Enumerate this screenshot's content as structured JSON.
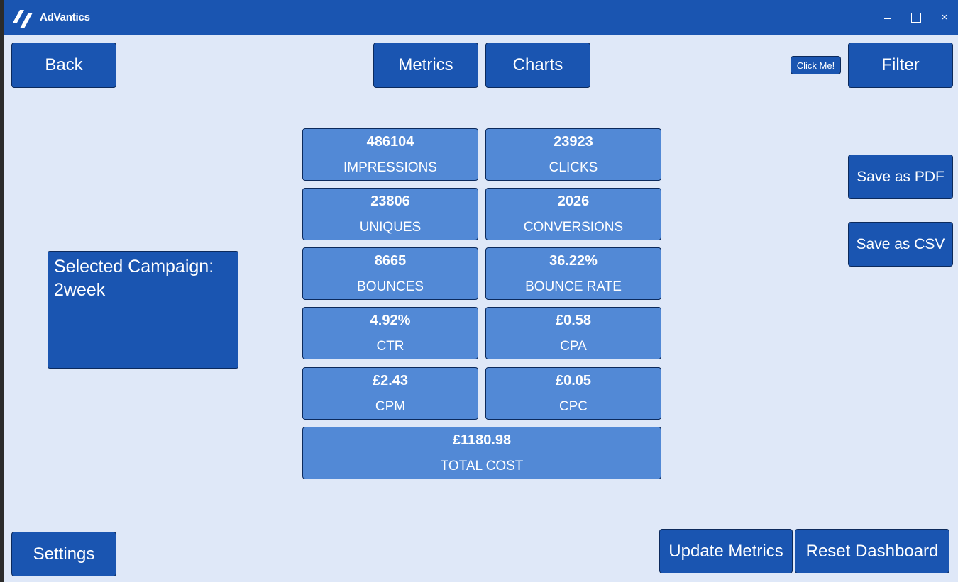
{
  "window": {
    "title": "AdVantics",
    "minimize": "–",
    "close": "×"
  },
  "nav": {
    "back": "Back",
    "metrics": "Metrics",
    "charts": "Charts",
    "click_me": "Click Me!",
    "filter": "Filter"
  },
  "actions": {
    "save_pdf": "Save as PDF",
    "save_csv": "Save as CSV",
    "settings": "Settings",
    "update_metrics": "Update Metrics",
    "reset_dashboard": "Reset Dashboard"
  },
  "campaign": {
    "label": "Selected Campaign:",
    "name": "2week"
  },
  "metrics": [
    {
      "value": "486104",
      "label": "IMPRESSIONS"
    },
    {
      "value": "23923",
      "label": "CLICKS"
    },
    {
      "value": "23806",
      "label": "UNIQUES"
    },
    {
      "value": "2026",
      "label": "CONVERSIONS"
    },
    {
      "value": "8665",
      "label": "BOUNCES"
    },
    {
      "value": "36.22%",
      "label": "BOUNCE RATE"
    },
    {
      "value": "4.92%",
      "label": "CTR"
    },
    {
      "value": "£0.58",
      "label": "CPA"
    },
    {
      "value": "£2.43",
      "label": "CPM"
    },
    {
      "value": "£0.05",
      "label": "CPC"
    },
    {
      "value": "£1180.98",
      "label": "TOTAL COST"
    }
  ],
  "colors": {
    "titlebar": "#1a55b1",
    "button": "#1a55b1",
    "metric_tile": "#5289d6",
    "background": "#dfe8f8"
  }
}
